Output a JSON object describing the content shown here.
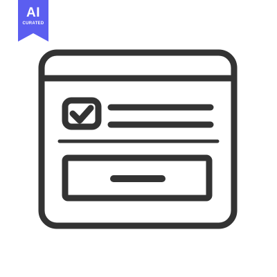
{
  "badge": {
    "main_text": "AI",
    "sub_text": "CURATED",
    "color": "#5b5ef0"
  },
  "illustration": {
    "icon": "browser-window-form-icon",
    "stroke_color": "#333333",
    "elements": {
      "window": "browser-window",
      "checkbox": "checked-checkbox",
      "text_lines": 2,
      "button": "submit-button"
    }
  }
}
